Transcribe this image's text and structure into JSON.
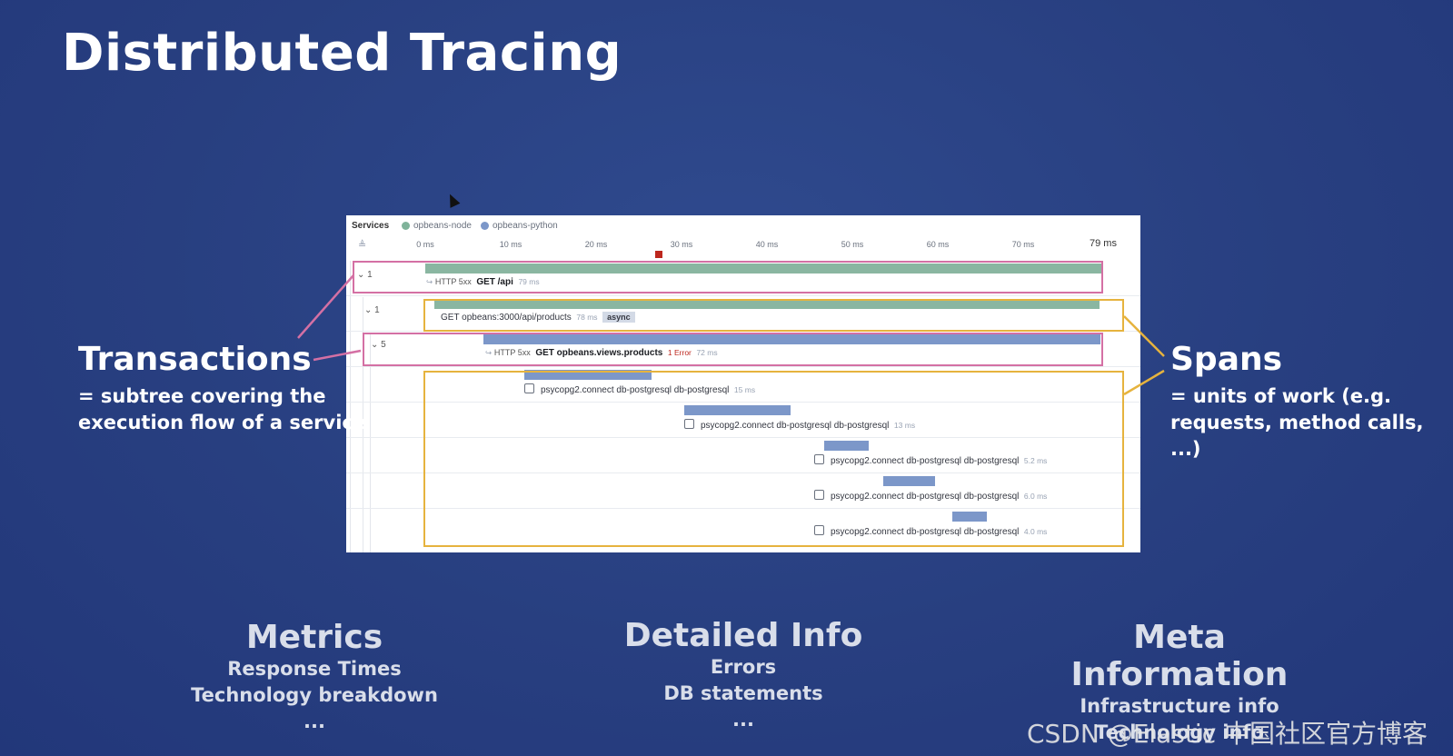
{
  "title": "Distributed Tracing",
  "trace": {
    "services_label": "Services",
    "legend": [
      {
        "name": "opbeans-node",
        "color": "#7fb39a"
      },
      {
        "name": "opbeans-python",
        "color": "#7c97c9"
      }
    ],
    "ticks": [
      "0 ms",
      "10 ms",
      "20 ms",
      "30 ms",
      "40 ms",
      "50 ms",
      "60 ms",
      "70 ms",
      "79 ms"
    ],
    "rows": [
      {
        "toggle": "1",
        "prefix": "HTTP 5xx",
        "name": "GET /api",
        "duration": "79 ms"
      },
      {
        "toggle": "1",
        "name": "GET opbeans:3000/api/products",
        "duration": "78 ms",
        "badge": "async"
      },
      {
        "toggle": "5",
        "prefix": "HTTP 5xx",
        "name": "GET opbeans.views.products",
        "error": "1 Error",
        "duration": "72 ms"
      },
      {
        "name": "psycopg2.connect db-postgresql db-postgresql",
        "duration": "15 ms"
      },
      {
        "name": "psycopg2.connect db-postgresql db-postgresql",
        "duration": "13 ms"
      },
      {
        "name": "psycopg2.connect db-postgresql db-postgresql",
        "duration": "5.2 ms"
      },
      {
        "name": "psycopg2.connect db-postgresql db-postgresql",
        "duration": "6.0 ms"
      },
      {
        "name": "psycopg2.connect db-postgresql db-postgresql",
        "duration": "4.0 ms"
      }
    ]
  },
  "transactions": {
    "heading": "Transactions",
    "line1": "= subtree covering the",
    "line2": "execution flow of a service"
  },
  "spans": {
    "heading": "Spans",
    "line1": "= units of work (e.g.",
    "line2": "requests, method calls, ...)"
  },
  "columns": [
    {
      "heading": "Metrics",
      "items": [
        "Response Times",
        "Technology breakdown",
        "..."
      ]
    },
    {
      "heading": "Detailed Info",
      "items": [
        "Errors",
        "DB statements",
        "..."
      ]
    },
    {
      "heading": "Meta Information",
      "items": [
        "Infrastructure info",
        "Technology info"
      ]
    }
  ],
  "watermark": "CSDN @Elastic 中国社区官方博客"
}
